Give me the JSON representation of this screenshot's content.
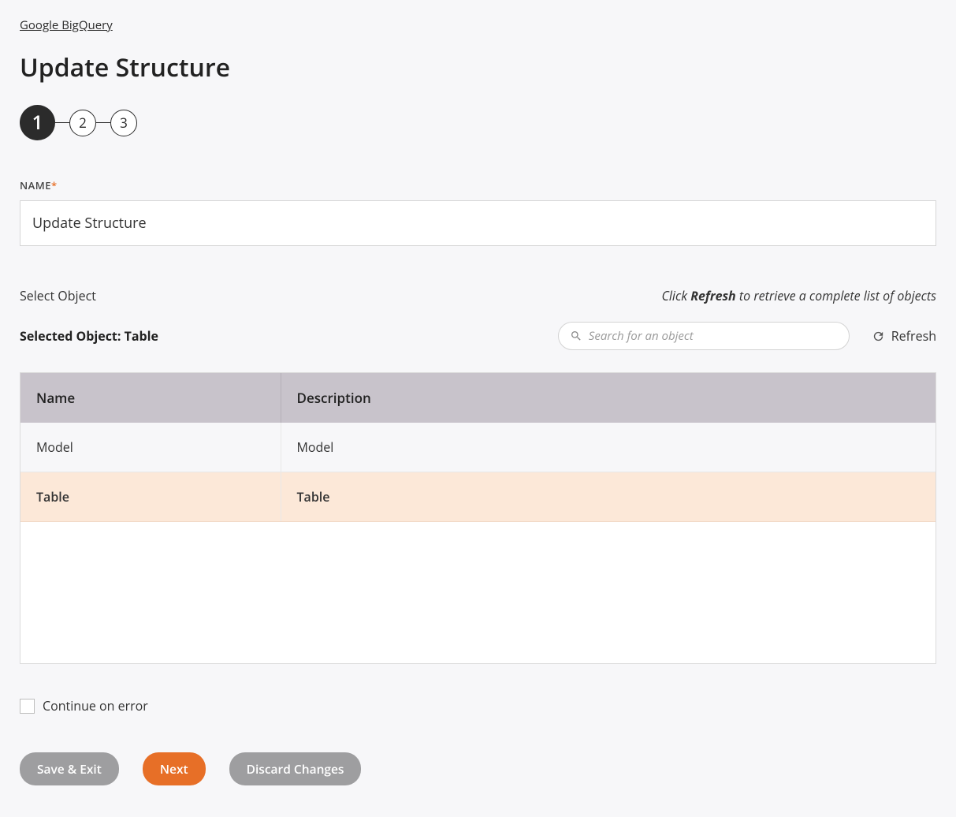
{
  "breadcrumb": "Google BigQuery",
  "page_title": "Update Structure",
  "stepper": {
    "steps": [
      "1",
      "2",
      "3"
    ],
    "active_index": 0
  },
  "form": {
    "name_label": "NAME",
    "name_value": "Update Structure"
  },
  "object_section": {
    "select_label": "Select Object",
    "hint_prefix": "Click ",
    "hint_bold": "Refresh",
    "hint_suffix": " to retrieve a complete list of objects",
    "selected_label_prefix": "Selected Object: ",
    "selected_value": "Table",
    "search_placeholder": "Search for an object",
    "refresh_label": "Refresh"
  },
  "table": {
    "headers": {
      "name": "Name",
      "description": "Description"
    },
    "rows": [
      {
        "name": "Model",
        "description": "Model",
        "selected": false
      },
      {
        "name": "Table",
        "description": "Table",
        "selected": true
      }
    ]
  },
  "continue_on_error_label": "Continue on error",
  "buttons": {
    "save_exit": "Save & Exit",
    "next": "Next",
    "discard": "Discard Changes"
  }
}
